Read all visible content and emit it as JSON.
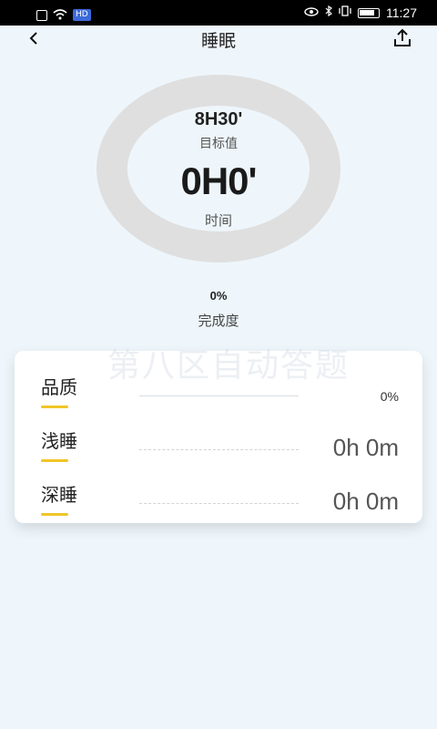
{
  "status_bar": {
    "hd_badge": "HD",
    "time": "11:27"
  },
  "nav": {
    "back_icon": "chevron-left-icon",
    "title": "睡眠",
    "share_icon": "share-upload-icon"
  },
  "ring": {
    "goal_value": "8H30'",
    "goal_label": "目标值",
    "time_value": "0H0'",
    "time_label": "时间"
  },
  "completion": {
    "value": "0%",
    "label": "完成度"
  },
  "watermark": "第八区自动答题",
  "stats": [
    {
      "label": "品质",
      "value": "0%"
    },
    {
      "label": "浅睡",
      "value": "0h 0m"
    },
    {
      "label": "深睡",
      "value": "0h 0m"
    }
  ],
  "colors": {
    "accent_underline": "#f0c528",
    "ring": "#dfdfdf",
    "background": "#eef6fb"
  }
}
